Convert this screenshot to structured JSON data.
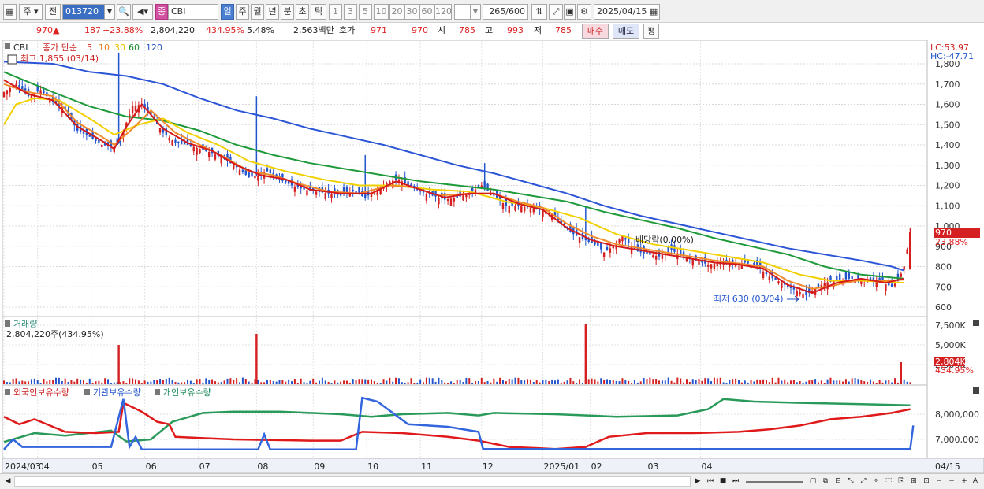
{
  "toolbar": {
    "market": "주",
    "prev_label": "전",
    "code": "013720",
    "name_prefix": "종",
    "name": "CBI",
    "periods": [
      "일",
      "주",
      "월",
      "년",
      "분",
      "초",
      "틱"
    ],
    "minute_options": [
      "1",
      "3",
      "5",
      "10",
      "20",
      "30",
      "60",
      "120"
    ],
    "count": "265",
    "count_total": "/600",
    "date": "2025/04/15"
  },
  "quote": {
    "price": "970",
    "change_arrow": "▲",
    "change": "187",
    "change_pct": "+23.88%",
    "volume": "2,804,220",
    "volume_pct": "434.95%",
    "turnover": "5.48%",
    "amount": "2,563백만",
    "hoga_label": "호가",
    "ask": "971",
    "bid": "970",
    "open_label": "시",
    "open": "785",
    "high_label": "고",
    "high": "993",
    "low_label": "저",
    "low": "785",
    "buy_btn": "매수",
    "sell_btn": "매도",
    "eval_btn": "평"
  },
  "price_panel": {
    "name": "CBI",
    "legend_prefix": "종가 단순",
    "ma_labels": [
      "5",
      "10",
      "30",
      "60",
      "120"
    ],
    "high_note": "최고 1,855 (03/14)",
    "low_note": "최저 630 (03/04)",
    "dividend_note": "배당락(0.00%)",
    "lc_label": "LC:53.97",
    "hc_label": "HC:-47.71",
    "last_price_tag": "970",
    "last_pct_tag": "23.88%"
  },
  "volume_panel": {
    "title": "거래량",
    "value_label": "2,804,220주(434.95%)",
    "last_tag": "2,804K",
    "last_pct": "434.95%"
  },
  "holdings_panel": {
    "legend": [
      "외국인보유수량",
      "기관보유수량",
      "개인보유수량"
    ]
  },
  "x_labels": [
    "2024/03",
    "04",
    "05",
    "06",
    "07",
    "08",
    "09",
    "10",
    "11",
    "12",
    "2025/01",
    "02",
    "03",
    "04"
  ],
  "x_right_label": "04/15",
  "chart_data": {
    "type": "candlestick",
    "y_ticks": [
      1800,
      1700,
      1600,
      1500,
      1400,
      1300,
      1200,
      1100,
      1000,
      900,
      800,
      700,
      600
    ],
    "volume_ticks": [
      "7,500K",
      "5,000K",
      "2,500K"
    ],
    "holding_ticks": [
      "8,000,000",
      "7,000,000"
    ],
    "ma_close": [
      [
        0,
        1660
      ],
      [
        8,
        1700
      ],
      [
        16,
        1640
      ],
      [
        24,
        1670
      ],
      [
        32,
        1610
      ],
      [
        40,
        1580
      ],
      [
        48,
        1470
      ],
      [
        56,
        1440
      ],
      [
        64,
        1400
      ],
      [
        72,
        1390
      ],
      [
        76,
        1410
      ],
      [
        80,
        1510
      ],
      [
        84,
        1590
      ],
      [
        90,
        1600
      ],
      [
        96,
        1550
      ],
      [
        104,
        1460
      ],
      [
        112,
        1410
      ],
      [
        120,
        1400
      ],
      [
        128,
        1380
      ],
      [
        136,
        1360
      ],
      [
        144,
        1330
      ],
      [
        152,
        1290
      ],
      [
        160,
        1240
      ],
      [
        166,
        1250
      ],
      [
        172,
        1270
      ],
      [
        180,
        1230
      ],
      [
        188,
        1200
      ],
      [
        196,
        1180
      ],
      [
        204,
        1170
      ],
      [
        212,
        1160
      ],
      [
        220,
        1150
      ],
      [
        228,
        1170
      ],
      [
        236,
        1140
      ],
      [
        244,
        1180
      ],
      [
        252,
        1220
      ],
      [
        258,
        1230
      ],
      [
        264,
        1200
      ],
      [
        272,
        1170
      ],
      [
        280,
        1150
      ],
      [
        288,
        1130
      ],
      [
        296,
        1140
      ],
      [
        304,
        1160
      ],
      [
        312,
        1200
      ],
      [
        320,
        1150
      ],
      [
        328,
        1100
      ],
      [
        336,
        1100
      ],
      [
        344,
        1090
      ],
      [
        352,
        1080
      ],
      [
        360,
        1050
      ],
      [
        364,
        1010
      ],
      [
        372,
        960
      ],
      [
        380,
        930
      ],
      [
        388,
        900
      ],
      [
        392,
        870
      ],
      [
        398,
        900
      ],
      [
        404,
        950
      ],
      [
        412,
        880
      ],
      [
        420,
        860
      ],
      [
        428,
        850
      ],
      [
        436,
        880
      ],
      [
        444,
        850
      ],
      [
        452,
        830
      ],
      [
        460,
        810
      ],
      [
        468,
        820
      ],
      [
        476,
        810
      ],
      [
        484,
        820
      ],
      [
        492,
        800
      ],
      [
        500,
        750
      ],
      [
        508,
        720
      ],
      [
        512,
        700
      ],
      [
        518,
        680
      ],
      [
        524,
        660
      ],
      [
        530,
        690
      ],
      [
        536,
        720
      ],
      [
        544,
        730
      ],
      [
        552,
        740
      ],
      [
        560,
        740
      ],
      [
        568,
        730
      ],
      [
        574,
        720
      ],
      [
        580,
        700
      ],
      [
        584,
        730
      ],
      [
        588,
        800
      ],
      [
        592,
        970
      ]
    ],
    "ma5": [
      [
        0,
        1720
      ],
      [
        16,
        1650
      ],
      [
        32,
        1620
      ],
      [
        48,
        1490
      ],
      [
        64,
        1420
      ],
      [
        72,
        1380
      ],
      [
        80,
        1490
      ],
      [
        90,
        1600
      ],
      [
        104,
        1480
      ],
      [
        120,
        1410
      ],
      [
        136,
        1370
      ],
      [
        152,
        1300
      ],
      [
        168,
        1250
      ],
      [
        184,
        1230
      ],
      [
        200,
        1180
      ],
      [
        220,
        1160
      ],
      [
        240,
        1160
      ],
      [
        256,
        1220
      ],
      [
        272,
        1180
      ],
      [
        288,
        1140
      ],
      [
        304,
        1160
      ],
      [
        320,
        1160
      ],
      [
        336,
        1110
      ],
      [
        352,
        1080
      ],
      [
        368,
        990
      ],
      [
        384,
        930
      ],
      [
        400,
        900
      ],
      [
        416,
        880
      ],
      [
        432,
        860
      ],
      [
        448,
        840
      ],
      [
        464,
        820
      ],
      [
        480,
        810
      ],
      [
        496,
        790
      ],
      [
        512,
        710
      ],
      [
        528,
        670
      ],
      [
        544,
        720
      ],
      [
        560,
        740
      ],
      [
        576,
        720
      ],
      [
        588,
        740
      ]
    ],
    "ma10": [
      [
        0,
        1700
      ],
      [
        16,
        1660
      ],
      [
        32,
        1640
      ],
      [
        48,
        1510
      ],
      [
        64,
        1440
      ],
      [
        72,
        1400
      ],
      [
        84,
        1480
      ],
      [
        96,
        1570
      ],
      [
        112,
        1460
      ],
      [
        128,
        1400
      ],
      [
        144,
        1340
      ],
      [
        160,
        1270
      ],
      [
        176,
        1250
      ],
      [
        192,
        1210
      ],
      [
        212,
        1170
      ],
      [
        232,
        1160
      ],
      [
        252,
        1200
      ],
      [
        268,
        1190
      ],
      [
        284,
        1150
      ],
      [
        304,
        1160
      ],
      [
        320,
        1160
      ],
      [
        336,
        1120
      ],
      [
        352,
        1090
      ],
      [
        368,
        1010
      ],
      [
        384,
        950
      ],
      [
        400,
        910
      ],
      [
        416,
        890
      ],
      [
        432,
        870
      ],
      [
        448,
        850
      ],
      [
        464,
        830
      ],
      [
        480,
        815
      ],
      [
        496,
        800
      ],
      [
        512,
        730
      ],
      [
        528,
        690
      ],
      [
        544,
        710
      ],
      [
        560,
        735
      ],
      [
        576,
        730
      ],
      [
        588,
        735
      ]
    ],
    "ma30": [
      [
        0,
        1500
      ],
      [
        8,
        1600
      ],
      [
        20,
        1630
      ],
      [
        36,
        1620
      ],
      [
        56,
        1530
      ],
      [
        72,
        1450
      ],
      [
        88,
        1500
      ],
      [
        104,
        1530
      ],
      [
        120,
        1460
      ],
      [
        140,
        1400
      ],
      [
        160,
        1320
      ],
      [
        184,
        1270
      ],
      [
        208,
        1230
      ],
      [
        232,
        1200
      ],
      [
        256,
        1200
      ],
      [
        280,
        1180
      ],
      [
        304,
        1170
      ],
      [
        328,
        1120
      ],
      [
        352,
        1090
      ],
      [
        376,
        1040
      ],
      [
        400,
        960
      ],
      [
        424,
        910
      ],
      [
        448,
        880
      ],
      [
        472,
        850
      ],
      [
        496,
        820
      ],
      [
        520,
        760
      ],
      [
        540,
        730
      ],
      [
        560,
        730
      ],
      [
        588,
        720
      ]
    ],
    "ma60": [
      [
        0,
        1760
      ],
      [
        16,
        1710
      ],
      [
        32,
        1660
      ],
      [
        56,
        1590
      ],
      [
        80,
        1540
      ],
      [
        104,
        1520
      ],
      [
        128,
        1470
      ],
      [
        152,
        1400
      ],
      [
        176,
        1350
      ],
      [
        200,
        1310
      ],
      [
        224,
        1280
      ],
      [
        248,
        1250
      ],
      [
        272,
        1220
      ],
      [
        296,
        1200
      ],
      [
        320,
        1180
      ],
      [
        344,
        1150
      ],
      [
        368,
        1120
      ],
      [
        392,
        1070
      ],
      [
        416,
        1030
      ],
      [
        440,
        990
      ],
      [
        464,
        940
      ],
      [
        488,
        900
      ],
      [
        512,
        860
      ],
      [
        536,
        800
      ],
      [
        560,
        760
      ],
      [
        588,
        740
      ]
    ],
    "ma120": [
      [
        0,
        1810
      ],
      [
        32,
        1800
      ],
      [
        56,
        1760
      ],
      [
        80,
        1740
      ],
      [
        104,
        1700
      ],
      [
        128,
        1630
      ],
      [
        152,
        1570
      ],
      [
        176,
        1530
      ],
      [
        200,
        1480
      ],
      [
        224,
        1440
      ],
      [
        248,
        1400
      ],
      [
        272,
        1350
      ],
      [
        296,
        1300
      ],
      [
        320,
        1260
      ],
      [
        344,
        1210
      ],
      [
        368,
        1160
      ],
      [
        392,
        1100
      ],
      [
        416,
        1050
      ],
      [
        440,
        1010
      ],
      [
        464,
        970
      ],
      [
        488,
        930
      ],
      [
        512,
        890
      ],
      [
        536,
        860
      ],
      [
        560,
        830
      ],
      [
        580,
        800
      ],
      [
        588,
        780
      ]
    ],
    "holdings_foreign": [
      [
        0,
        7900
      ],
      [
        10,
        7600
      ],
      [
        20,
        7800
      ],
      [
        40,
        7300
      ],
      [
        60,
        7250
      ],
      [
        75,
        7300
      ],
      [
        78,
        8450
      ],
      [
        90,
        8100
      ],
      [
        100,
        7700
      ],
      [
        108,
        7600
      ],
      [
        112,
        7100
      ],
      [
        130,
        7050
      ],
      [
        150,
        7000
      ],
      [
        170,
        6980
      ],
      [
        200,
        6950
      ],
      [
        220,
        6950
      ],
      [
        234,
        7300
      ],
      [
        260,
        7250
      ],
      [
        290,
        7100
      ],
      [
        310,
        6950
      ],
      [
        330,
        6700
      ],
      [
        350,
        6650
      ],
      [
        360,
        6620
      ],
      [
        380,
        6700
      ],
      [
        395,
        7100
      ],
      [
        420,
        7250
      ],
      [
        450,
        7250
      ],
      [
        480,
        7300
      ],
      [
        500,
        7400
      ],
      [
        520,
        7550
      ],
      [
        540,
        7800
      ],
      [
        560,
        7900
      ],
      [
        580,
        8050
      ],
      [
        592,
        8200
      ]
    ],
    "holdings_inst": [
      [
        0,
        6600
      ],
      [
        6,
        7000
      ],
      [
        12,
        6700
      ],
      [
        70,
        6700
      ],
      [
        78,
        8600
      ],
      [
        82,
        6700
      ],
      [
        86,
        7100
      ],
      [
        90,
        6600
      ],
      [
        166,
        6600
      ],
      [
        170,
        7200
      ],
      [
        174,
        6600
      ],
      [
        230,
        6600
      ],
      [
        234,
        8650
      ],
      [
        244,
        8500
      ],
      [
        254,
        8050
      ],
      [
        264,
        7600
      ],
      [
        290,
        7500
      ],
      [
        310,
        7300
      ],
      [
        313,
        6620
      ],
      [
        592,
        6620
      ],
      [
        594,
        7550
      ]
    ],
    "holdings_indiv": [
      [
        0,
        6900
      ],
      [
        20,
        7250
      ],
      [
        40,
        7150
      ],
      [
        70,
        7350
      ],
      [
        80,
        6920
      ],
      [
        96,
        7000
      ],
      [
        110,
        7700
      ],
      [
        130,
        8050
      ],
      [
        150,
        8100
      ],
      [
        180,
        8100
      ],
      [
        200,
        8050
      ],
      [
        220,
        8000
      ],
      [
        240,
        7900
      ],
      [
        260,
        8000
      ],
      [
        290,
        8050
      ],
      [
        310,
        7950
      ],
      [
        320,
        8050
      ],
      [
        360,
        8000
      ],
      [
        400,
        7900
      ],
      [
        440,
        7950
      ],
      [
        460,
        8200
      ],
      [
        470,
        8600
      ],
      [
        490,
        8500
      ],
      [
        520,
        8450
      ],
      [
        560,
        8400
      ],
      [
        592,
        8350
      ]
    ],
    "volume_spikes": [
      [
        75,
        5000
      ],
      [
        165,
        6400
      ],
      [
        380,
        7600
      ],
      [
        586,
        2800
      ]
    ],
    "last_price": 970,
    "price_axis_max": 1855,
    "price_axis_min": 600
  }
}
